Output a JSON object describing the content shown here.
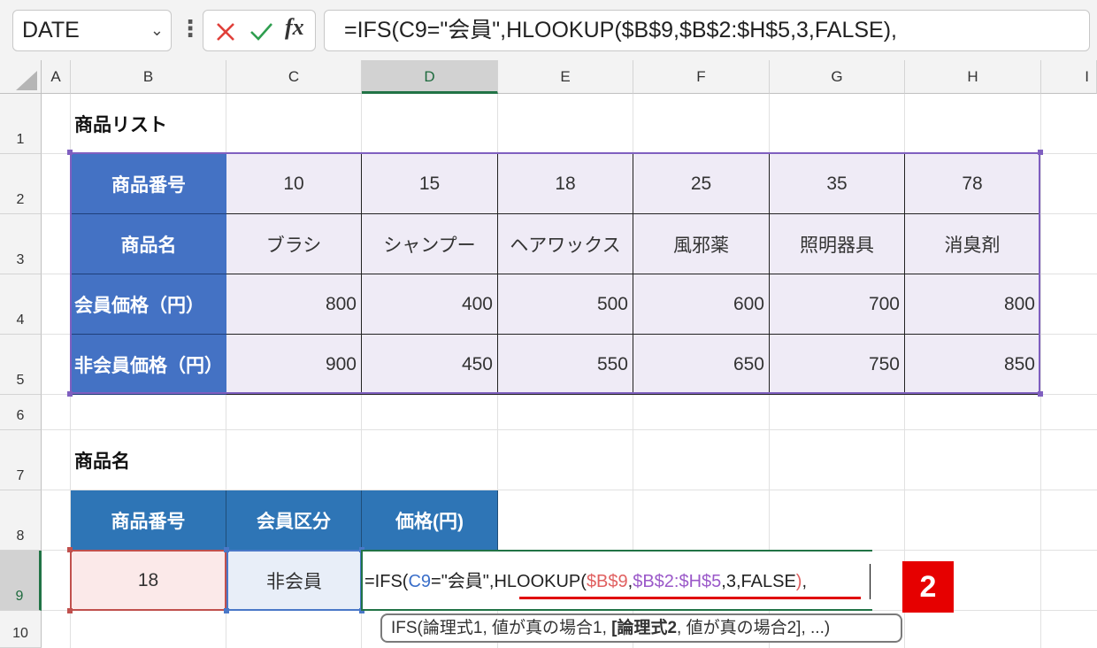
{
  "formula_bar": {
    "name_box": "DATE",
    "fx_label": "fx",
    "formula": "=IFS(C9=\"会員\",HLOOKUP($B$9,$B$2:$H$5,3,FALSE),"
  },
  "columns": [
    "A",
    "B",
    "C",
    "D",
    "E",
    "F",
    "G",
    "H",
    "I"
  ],
  "rows": [
    "1",
    "2",
    "3",
    "4",
    "5",
    "6",
    "7",
    "8",
    "9",
    "10"
  ],
  "sheet": {
    "list_title": "商品リスト",
    "table_headers": [
      "商品番号",
      "商品名",
      "会員価格（円）",
      "非会員価格（円）"
    ],
    "product_numbers": [
      "10",
      "15",
      "18",
      "25",
      "35",
      "78"
    ],
    "product_names": [
      "ブラシ",
      "シャンプー",
      "ヘアワックス",
      "風邪薬",
      "照明器具",
      "消臭剤"
    ],
    "member_prices": [
      "800",
      "400",
      "500",
      "600",
      "700",
      "800"
    ],
    "nonmember_prices": [
      "900",
      "450",
      "550",
      "650",
      "750",
      "850"
    ],
    "lookup_title": "商品名",
    "lookup_headers": [
      "商品番号",
      "会員区分",
      "価格(円)"
    ],
    "lookup_values": {
      "product_number": "18",
      "member_type": "非会員"
    },
    "editing_formula": {
      "prefix": "=IFS(",
      "ref1": "C9",
      "mid1": "=\"会員\",",
      "func": "HLOOKUP(",
      "ref2": "$B$9",
      "comma": ",",
      "ref3": "$B$2:$H$5",
      "args": ",3,FALSE",
      "close": ")",
      "trail": ","
    }
  },
  "tooltip": {
    "part1": "IFS(論理式1, 値が真の場合1, ",
    "bold": "[論理式2",
    "part2": ", 値が真の場合2], ...)"
  },
  "badge": "2",
  "colors": {
    "header_blue": "#4472c4",
    "header_blue2": "#2e75b6",
    "table_fill": "#efebf6",
    "excel_green": "#217346",
    "badge_red": "#e60000"
  }
}
